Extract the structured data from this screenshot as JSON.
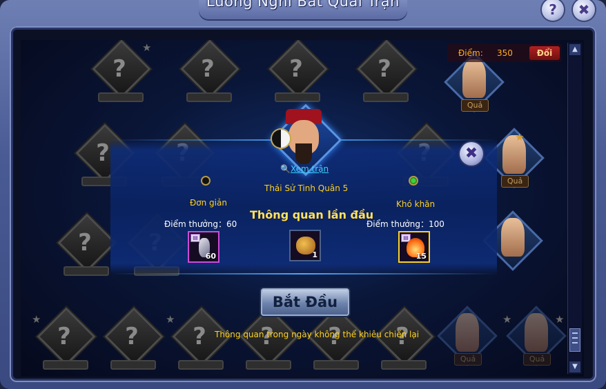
{
  "title": "Lương Nghi Bát Quái Trận",
  "header": {
    "help_icon": "?",
    "close_icon": "✖"
  },
  "score": {
    "label": "Điểm:",
    "value": "350",
    "redeem_label": "Đổi"
  },
  "stage": {
    "view_link": "Xem trận",
    "boss_name": "Thái Sử Tinh Quân 5",
    "first_clear_label": "Thông quan lần đầu",
    "start_button": "Bắt Đầu",
    "notice": "Thông quan trong ngày không thể khiêu chiến lại",
    "middle_reward": {
      "count": "1"
    }
  },
  "difficulty": {
    "easy": {
      "label": "Đơn giản",
      "reward_label": "Điểm thưởng：60",
      "item_count": "60",
      "selected": false
    },
    "hard": {
      "label": "Khó khăn",
      "reward_label": "Điểm thưởng：100",
      "item_count": "15",
      "selected": true
    }
  },
  "map": {
    "unknown_symbol": "?",
    "char_badge": "Quả"
  },
  "colors": {
    "accent_yellow": "#ffd21e",
    "easy_item_border": "#d04ad8",
    "hard_item_border": "#ffd21e",
    "link": "#3ecfff"
  },
  "icons": {
    "star": "star-icon",
    "magnifier": "magnifier-icon",
    "close": "close-icon",
    "help": "help-icon"
  }
}
